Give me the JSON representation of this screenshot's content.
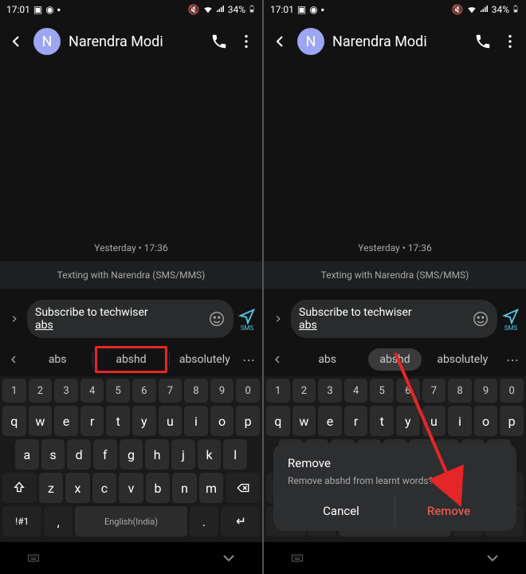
{
  "status": {
    "time": "17:01",
    "battery": "34%"
  },
  "header": {
    "contact_name": "Narendra Modi",
    "avatar_letter": "N"
  },
  "conversation": {
    "timestamp": "Yesterday • 17:36",
    "texting_with": "Texting with Narendra  (SMS/MMS)"
  },
  "compose": {
    "text_line1": "Subscribe to techwiser",
    "text_underlined": "abs",
    "send_label": "SMS"
  },
  "suggestions": {
    "s1": "abs",
    "s2": "abshd",
    "s3": "absolutely"
  },
  "keyboard": {
    "numbers": [
      "1",
      "2",
      "3",
      "4",
      "5",
      "6",
      "7",
      "8",
      "9",
      "0"
    ],
    "row1": [
      "q",
      "w",
      "e",
      "r",
      "t",
      "y",
      "u",
      "i",
      "o",
      "p"
    ],
    "row2": [
      "a",
      "s",
      "d",
      "f",
      "g",
      "h",
      "j",
      "k",
      "l"
    ],
    "row3": [
      "z",
      "x",
      "c",
      "v",
      "b",
      "n",
      "m"
    ],
    "symbol_key": "!#1",
    "space_label": "English(India)",
    "comma": ",",
    "period": "."
  },
  "dialog": {
    "title": "Remove",
    "message": "Remove abshd from learnt words?",
    "cancel": "Cancel",
    "remove": "Remove"
  }
}
